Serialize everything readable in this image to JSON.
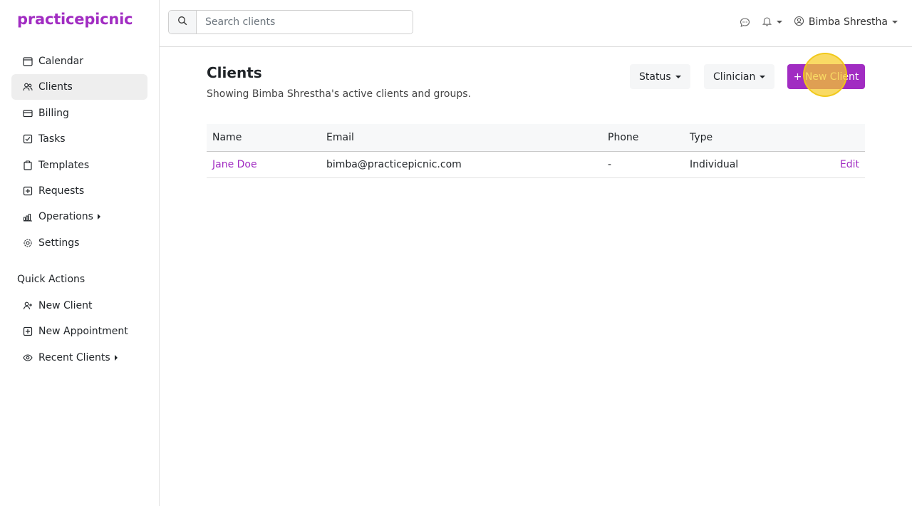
{
  "brand": {
    "name": "practicepicnic",
    "color": "#a12cc2"
  },
  "sidebar": {
    "items": [
      {
        "label": "Calendar",
        "icon": "calendar-icon"
      },
      {
        "label": "Clients",
        "icon": "users-icon",
        "active": true
      },
      {
        "label": "Billing",
        "icon": "credit-card-icon"
      },
      {
        "label": "Tasks",
        "icon": "checkbox-icon"
      },
      {
        "label": "Templates",
        "icon": "clipboard-icon"
      },
      {
        "label": "Requests",
        "icon": "plus-square-icon"
      },
      {
        "label": "Operations",
        "icon": "bar-chart-icon",
        "has_submenu": true
      },
      {
        "label": "Settings",
        "icon": "gear-icon"
      }
    ],
    "quick_actions_title": "Quick Actions",
    "quick_actions": [
      {
        "label": "New Client",
        "icon": "user-plus-icon"
      },
      {
        "label": "New Appointment",
        "icon": "plus-square-icon"
      },
      {
        "label": "Recent Clients",
        "icon": "eye-icon",
        "has_submenu": true
      }
    ]
  },
  "header": {
    "search": {
      "placeholder": "Search clients",
      "value": ""
    },
    "user_name": "Bimba Shrestha"
  },
  "main": {
    "title": "Clients",
    "subtitle": "Showing Bimba Shrestha's active clients and groups.",
    "filters": {
      "status_label": "Status",
      "clinician_label": "Clinician"
    },
    "new_client_label": "+ New Client",
    "table": {
      "columns": [
        "Name",
        "Email",
        "Phone",
        "Type"
      ],
      "rows": [
        {
          "name": "Jane Doe",
          "email": "bimba@practicepicnic.com",
          "phone": "-",
          "type": "Individual",
          "action": "Edit"
        }
      ]
    }
  }
}
